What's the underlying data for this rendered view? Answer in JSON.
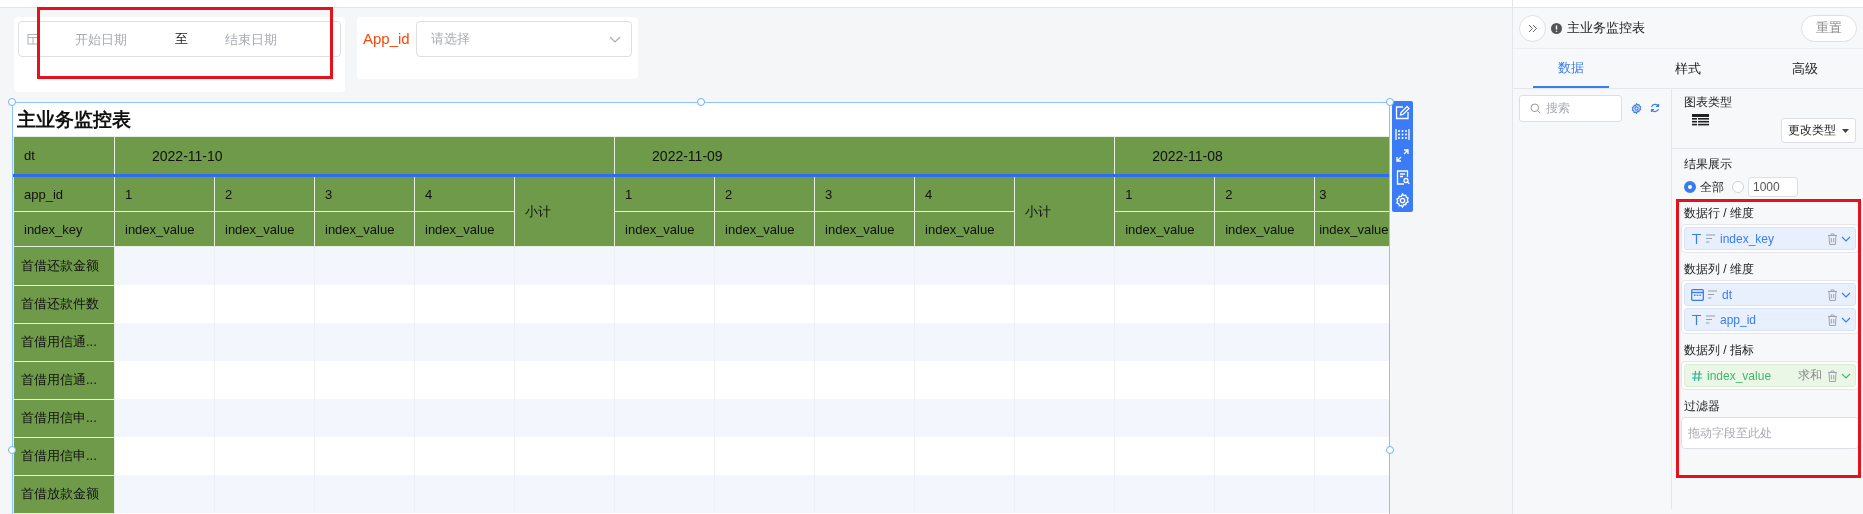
{
  "filters": {
    "date_range": {
      "start_placeholder": "开始日期",
      "separator": "至",
      "end_placeholder": "结束日期",
      "highlighted": true
    },
    "app_select": {
      "label": "App_id",
      "placeholder": "请选择"
    }
  },
  "chart": {
    "title": "主业务监控表",
    "selected": true,
    "corner_labels": [
      "dt",
      "app_id",
      "index_key"
    ],
    "groups": [
      {
        "date": "2022-11-10",
        "subtotal": "小计",
        "apps": [
          {
            "id": "1",
            "measure": "index_value"
          },
          {
            "id": "2",
            "measure": "index_value"
          },
          {
            "id": "3",
            "measure": "index_value"
          },
          {
            "id": "4",
            "measure": "index_value"
          }
        ]
      },
      {
        "date": "2022-11-09",
        "subtotal": "小计",
        "apps": [
          {
            "id": "1",
            "measure": "index_value"
          },
          {
            "id": "2",
            "measure": "index_value"
          },
          {
            "id": "3",
            "measure": "index_value"
          },
          {
            "id": "4",
            "measure": "index_value"
          }
        ]
      },
      {
        "date": "2022-11-08",
        "apps": [
          {
            "id": "1",
            "measure": "index_value"
          },
          {
            "id": "2",
            "measure": "index_value"
          },
          {
            "id": "3",
            "measure": "index_value"
          }
        ]
      }
    ],
    "row_labels": [
      "首借还款金额",
      "首借还款件数",
      "首借用信通...",
      "首借用信通...",
      "首借用信申...",
      "首借用信申...",
      "首借放款金额"
    ]
  },
  "config_panel": {
    "title": "主业务监控表",
    "reset_button": "重置",
    "tabs": [
      {
        "label": "数据",
        "selected": true
      },
      {
        "label": "样式",
        "selected": false
      },
      {
        "label": "高级",
        "selected": false
      }
    ],
    "search": {
      "placeholder": "搜索"
    },
    "chart_type": {
      "label": "图表类型",
      "button": "更改类型"
    },
    "result": {
      "label": "结果展示",
      "options": [
        {
          "kind": "radio",
          "label": "全部",
          "selected": true
        },
        {
          "kind": "radio-input",
          "value": "1000",
          "selected": false
        }
      ]
    },
    "fields_highlighted": true,
    "sections": [
      {
        "kind": "dimension",
        "label": "数据行 / 维度",
        "fields": [
          {
            "name": "index_key",
            "kind": "text"
          }
        ]
      },
      {
        "kind": "dimension",
        "label": "数据列 / 维度",
        "fields": [
          {
            "name": "dt",
            "kind": "date"
          },
          {
            "name": "app_id",
            "kind": "text"
          }
        ]
      },
      {
        "kind": "measure",
        "label": "数据列 / 指标",
        "fields": [
          {
            "name": "index_value",
            "kind": "number",
            "aggregation": "求和"
          }
        ]
      },
      {
        "kind": "drop",
        "label": "过滤器",
        "placeholder": "拖动字段至此处"
      }
    ]
  }
}
